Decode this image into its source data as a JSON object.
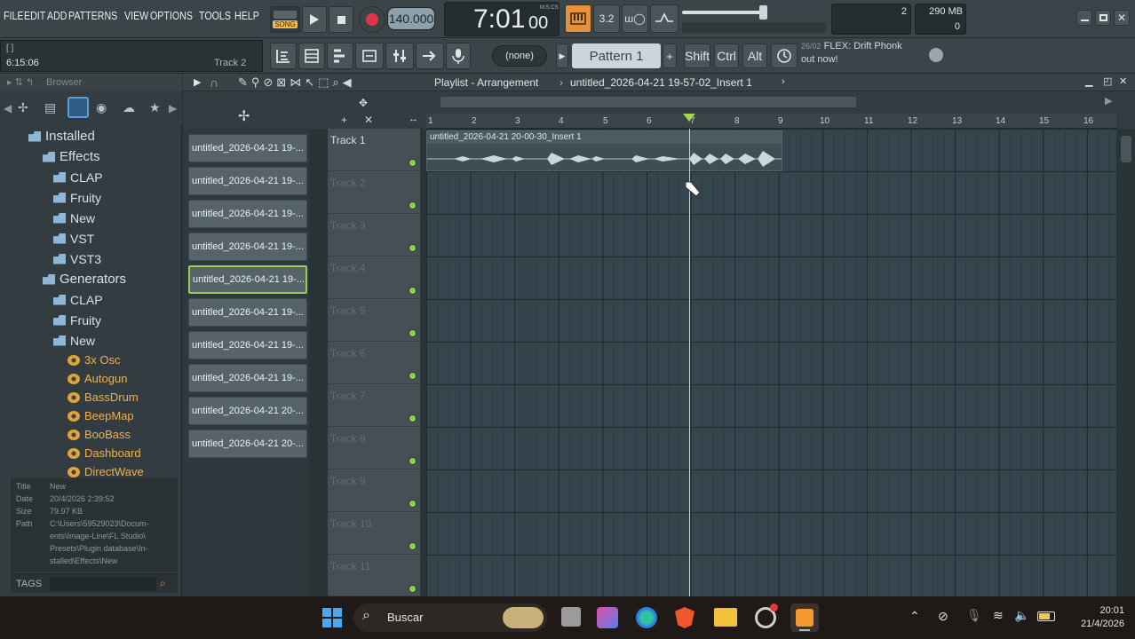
{
  "menu": [
    "FILE",
    "EDIT",
    "ADD",
    "PATTERNS",
    "VIEW",
    "OPTIONS",
    "TOOLS",
    "HELP"
  ],
  "transport": {
    "mode_label": "SONG",
    "tempo": "140.000",
    "time": "7:01",
    "time_sub": "00",
    "time_unit": "M:S:CS"
  },
  "mem": {
    "value": "290 MB",
    "cpu": "2",
    "poly": "0"
  },
  "hint": {
    "line1": "[   ]",
    "time": "6:15:06",
    "track": "Track 2"
  },
  "pattern_selector": {
    "none_label": "(none)",
    "pattern_label": "Pattern 1",
    "plus": "+"
  },
  "modifiers": [
    "Shift",
    "Ctrl",
    "Alt"
  ],
  "news": {
    "date": "26/02",
    "text": "FLEX: Drift Phonk",
    "text2": "out now!"
  },
  "browser": {
    "title": "Browser",
    "tree": [
      {
        "label": "Installed",
        "level": 0,
        "type": "folder"
      },
      {
        "label": "Effects",
        "level": 1,
        "type": "folder"
      },
      {
        "label": "CLAP",
        "level": 2,
        "type": "folder"
      },
      {
        "label": "Fruity",
        "level": 2,
        "type": "folder"
      },
      {
        "label": "New",
        "level": 2,
        "type": "folder"
      },
      {
        "label": "VST",
        "level": 2,
        "type": "folder"
      },
      {
        "label": "VST3",
        "level": 2,
        "type": "folder"
      },
      {
        "label": "Generators",
        "level": 1,
        "type": "folder"
      },
      {
        "label": "CLAP",
        "level": 2,
        "type": "folder"
      },
      {
        "label": "Fruity",
        "level": 2,
        "type": "folder"
      },
      {
        "label": "New",
        "level": 2,
        "type": "folder"
      },
      {
        "label": "3x Osc",
        "level": 3,
        "type": "plugin"
      },
      {
        "label": "Autogun",
        "level": 3,
        "type": "plugin"
      },
      {
        "label": "BassDrum",
        "level": 3,
        "type": "plugin"
      },
      {
        "label": "BeepMap",
        "level": 3,
        "type": "plugin"
      },
      {
        "label": "BooBass",
        "level": 3,
        "type": "plugin"
      },
      {
        "label": "Dashboard",
        "level": 3,
        "type": "plugin"
      },
      {
        "label": "DirectWave",
        "level": 3,
        "type": "plugin"
      }
    ],
    "info": {
      "title_label": "Title",
      "title": "New",
      "date_label": "Date",
      "date": "20/4/2026 2:39:52",
      "size_label": "Size",
      "size": "79.97 KB",
      "path_label": "Path",
      "path_lines": [
        "C:\\Users\\59529023\\Docum-",
        "ents\\Image-Line\\FL Studio\\",
        "Presets\\Plugin database\\In-",
        "stalled\\Effects\\New"
      ]
    },
    "tags_label": "TAGS"
  },
  "playlist": {
    "title": "Playlist - Arrangement",
    "sep": "›",
    "name": "untitled_2026-04-21 19-57-02_Insert 1",
    "clip_name": "untitled_2026-04-21 20-00-30_Insert 1",
    "ruler": [
      "1",
      "2",
      "3",
      "4",
      "5",
      "6",
      "7",
      "8",
      "9",
      "10",
      "11",
      "12",
      "13",
      "14",
      "15",
      "16"
    ],
    "tracks": [
      "Track 1",
      "Track 2",
      "Track 3",
      "Track 4",
      "Track 5",
      "Track 6",
      "Track 7",
      "Track 8",
      "Track 9",
      "Track 10",
      "Track 11"
    ],
    "patterns": [
      "untitled_2026-04-21 19-...",
      "untitled_2026-04-21 19-...",
      "untitled_2026-04-21 19-...",
      "untitled_2026-04-21 19-...",
      "untitled_2026-04-21 19-...",
      "untitled_2026-04-21 19-...",
      "untitled_2026-04-21 19-...",
      "untitled_2026-04-21 19-...",
      "untitled_2026-04-21 20-...",
      "untitled_2026-04-21 20-..."
    ]
  },
  "taskbar": {
    "search": "Buscar",
    "clock_time": "20:01",
    "clock_date": "21/4/2026"
  },
  "colors": {
    "accent_green": "#8fd14b",
    "plugin_orange": "#f0b04a",
    "playhead": "#a5d84b"
  }
}
